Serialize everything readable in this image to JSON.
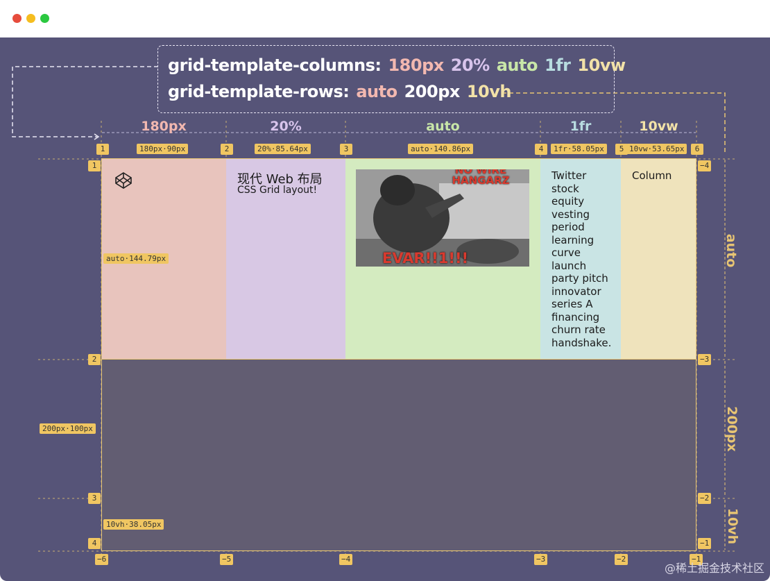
{
  "window": {
    "dots": [
      "#e64c3c",
      "#f5bd1f",
      "#2bc840"
    ]
  },
  "code": {
    "line1_prop": "grid-template-columns:",
    "line1_vals": [
      {
        "text": "180px",
        "color": "#f2b8b0"
      },
      {
        "text": "20%",
        "color": "#d8c4ec"
      },
      {
        "text": "auto",
        "color": "#c8e6a8"
      },
      {
        "text": "1fr",
        "color": "#b8dce0"
      },
      {
        "text": "10vw",
        "color": "#f2e2a8"
      }
    ],
    "line2_prop": "grid-template-rows:",
    "line2_vals": [
      {
        "text": "auto",
        "color": "#f2b8b0"
      },
      {
        "text": "200px",
        "color": "#ffffff"
      },
      {
        "text": "10vh",
        "color": "#f2e2a8"
      }
    ]
  },
  "columns": {
    "heads": [
      "180px",
      "20%",
      "auto",
      "1fr",
      "10vw"
    ],
    "head_colors": [
      "#f2b8b0",
      "#d8c4ec",
      "#c8e6a8",
      "#b8dce0",
      "#f2e2a8"
    ],
    "size_tags": [
      "180px·90px",
      "20%·85.64px",
      "auto·140.86px",
      "1fr·58.05px",
      "10vw·53.65px"
    ],
    "top_numbers": [
      "1",
      "2",
      "3",
      "4",
      "5",
      "6"
    ],
    "bottom_numbers": [
      "−6",
      "−5",
      "−4",
      "−3",
      "−2",
      "−1"
    ]
  },
  "rows": {
    "heads": [
      "auto",
      "200px",
      "10vh"
    ],
    "size_tags": [
      "auto·144.79px",
      "200px·100px",
      "10vh·38.05px"
    ],
    "left_numbers": [
      "1",
      "2",
      "3",
      "4"
    ],
    "right_numbers": [
      "−4",
      "−3",
      "−2",
      "−1"
    ]
  },
  "cells": {
    "cell2_title": "现代 Web 布局",
    "cell2_subtitle": "CSS Grid layout!",
    "meme_top": "NO WIRE HANGARZ",
    "meme_bottom": "EVAR!!1!!!",
    "cell4_text": [
      "Twitter",
      "stock",
      "equity",
      "vesting",
      "period",
      "learning",
      "curve",
      "launch",
      "party pitch",
      "innovator",
      "series A",
      "financing",
      "churn rate",
      "handshake."
    ],
    "cell5_text": "Column"
  },
  "cell_colors": [
    "#e8c4bd",
    "#d8c8e4",
    "#d4ebc0",
    "#c9e4e4",
    "#efe3bc"
  ],
  "watermark": "@稀土掘金技术社区"
}
